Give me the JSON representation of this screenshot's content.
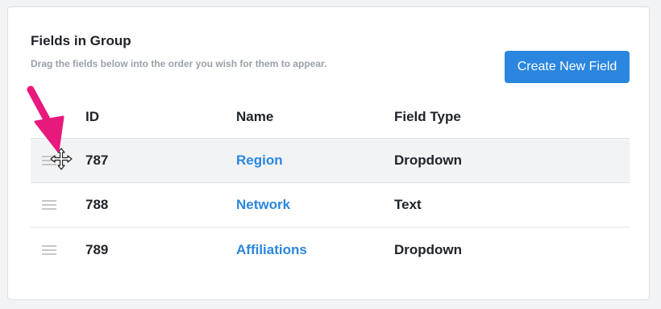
{
  "panel": {
    "title": "Fields in Group",
    "subtitle": "Drag the fields below into the order you wish for them to appear.",
    "create_button_label": "Create New Field"
  },
  "table": {
    "columns": [
      "ID",
      "Name",
      "Field Type"
    ],
    "rows": [
      {
        "id": "787",
        "name": "Region",
        "field_type": "Dropdown"
      },
      {
        "id": "788",
        "name": "Network",
        "field_type": "Text"
      },
      {
        "id": "789",
        "name": "Affiliations",
        "field_type": "Dropdown"
      }
    ]
  },
  "icons": {
    "drag_handle": "drag-handle-icon",
    "move_cursor": "move-cursor-icon",
    "annotation_arrow": "pointer-arrow-icon"
  },
  "colors": {
    "accent": "#2a86df",
    "annotation": "#e8197d",
    "active_row": "#f2f3f5"
  }
}
